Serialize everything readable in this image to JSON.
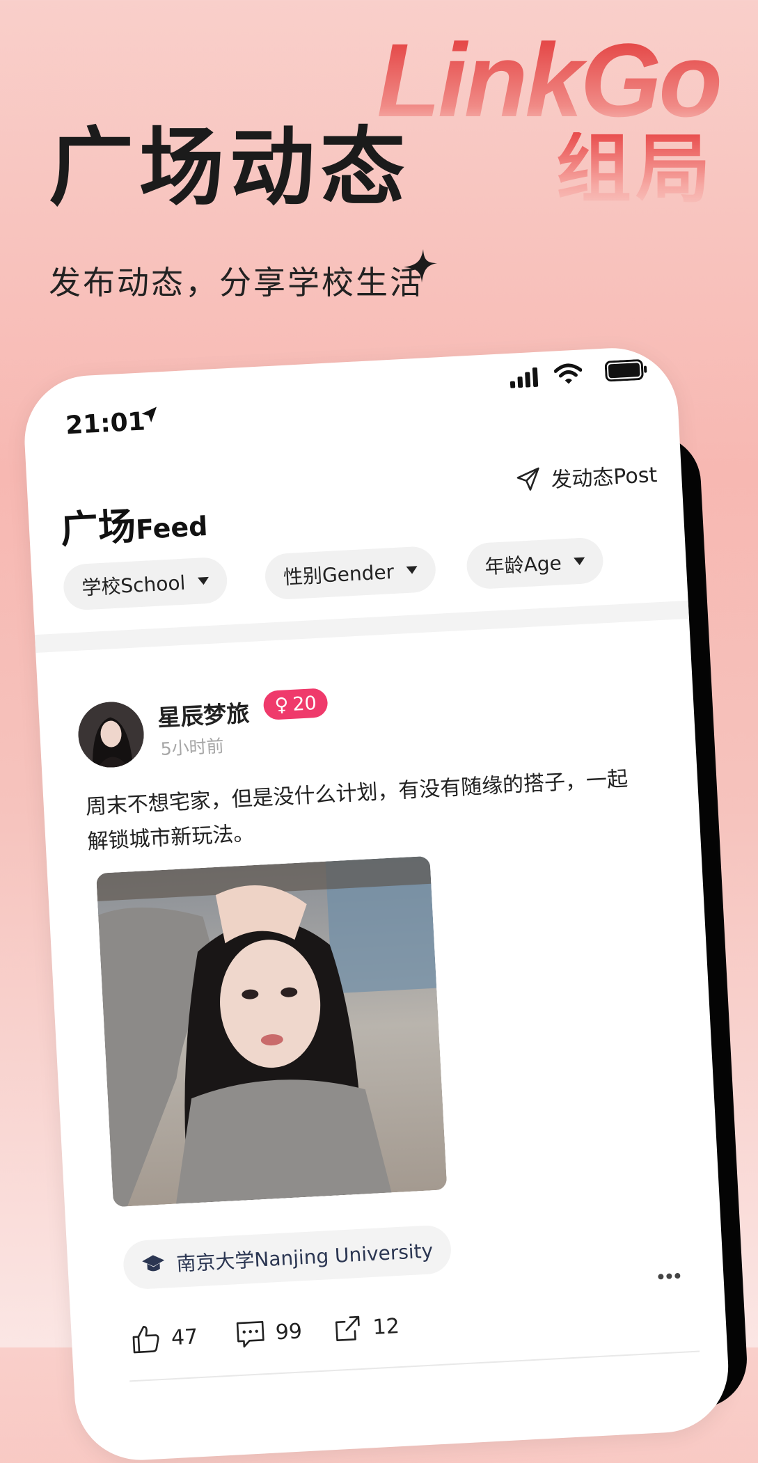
{
  "promo": {
    "title": "广场动态",
    "subtitle": "发布动态，分享学校生活",
    "brand_name": "LinkGo",
    "brand_tagline": "组局"
  },
  "status_bar": {
    "time": "21:01"
  },
  "header": {
    "title": "广场",
    "title_sub": "Feed",
    "post_label": "发动态Post"
  },
  "filters": [
    {
      "label": "学校School"
    },
    {
      "label": "性别Gender"
    },
    {
      "label": "年龄Age"
    }
  ],
  "post": {
    "username": "星辰梦旅",
    "gender_symbol": "♀",
    "age": "20",
    "time": "5小时前",
    "text": "周末不想宅家，但是没什么计划，有没有随缘的搭子，一起解锁城市新玩法。",
    "school": "南京大学Nanjing University",
    "likes": "47",
    "comments": "99",
    "shares": "12"
  },
  "colors": {
    "accent": "#ef3a6b",
    "brand": "#e23a3a",
    "background_top": "#f9cfca"
  }
}
